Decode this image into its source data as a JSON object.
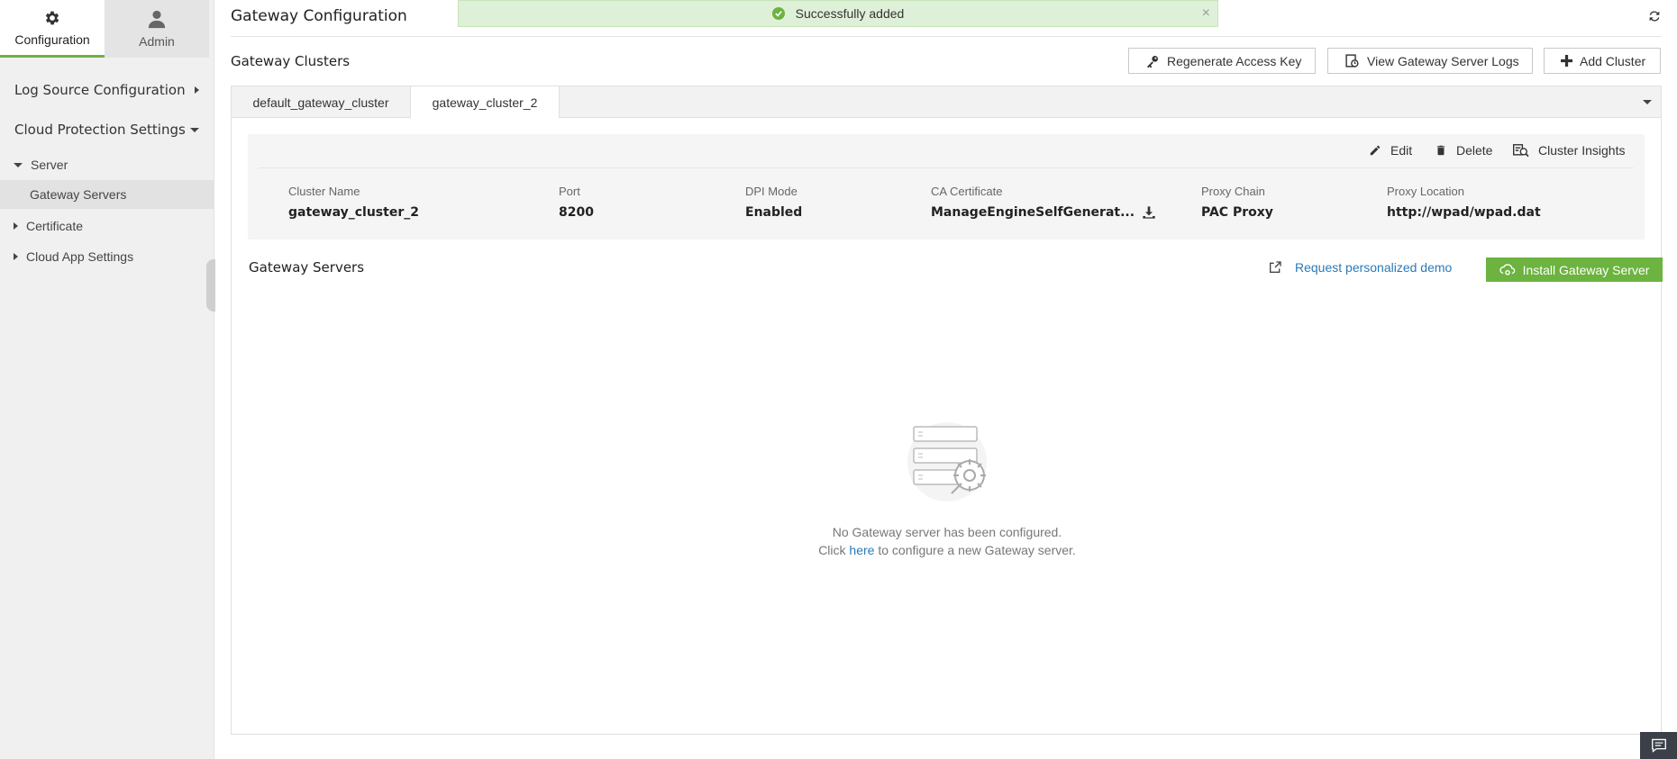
{
  "sidebar": {
    "top_tabs": [
      {
        "label": "Configuration",
        "icon": "gear-icon",
        "active": true
      },
      {
        "label": "Admin",
        "icon": "user-icon",
        "active": false
      }
    ],
    "sections": [
      {
        "label": "Log Source Configuration"
      },
      {
        "label": "Cloud Protection Settings"
      }
    ],
    "items": [
      {
        "label": "Server"
      },
      {
        "label": "Gateway Servers"
      },
      {
        "label": "Certificate"
      },
      {
        "label": "Cloud App Settings"
      }
    ]
  },
  "header": {
    "title": "Gateway Configuration",
    "toast": "Successfully added"
  },
  "clusters": {
    "title": "Gateway Clusters",
    "buttons": {
      "regenerate": "Regenerate Access Key",
      "view_logs": "View Gateway Server Logs",
      "add_cluster": "Add Cluster"
    },
    "tabs": [
      "default_gateway_cluster",
      "gateway_cluster_2"
    ],
    "active_tab": "gateway_cluster_2"
  },
  "card": {
    "actions": {
      "edit": "Edit",
      "delete": "Delete",
      "insights": "Cluster Insights"
    },
    "fields": [
      {
        "label": "Cluster Name",
        "value": "gateway_cluster_2"
      },
      {
        "label": "Port",
        "value": "8200"
      },
      {
        "label": "DPI Mode",
        "value": "Enabled"
      },
      {
        "label": "CA Certificate",
        "value": "ManageEngineSelfGenerat..."
      },
      {
        "label": "Proxy Chain",
        "value": "PAC Proxy"
      },
      {
        "label": "Proxy Location",
        "value": "http://wpad/wpad.dat"
      }
    ]
  },
  "servers": {
    "title": "Gateway Servers",
    "demo_link": "Request personalized demo",
    "install_button": "Install Gateway Server",
    "empty_line1": "No Gateway server has been configured.",
    "empty_click": "Click",
    "empty_here": "here",
    "empty_rest": "to configure a new Gateway server."
  },
  "colors": {
    "accent_green": "#6cb33f",
    "link_blue": "#2b7ab8",
    "toast_bg": "#dff0d8"
  }
}
